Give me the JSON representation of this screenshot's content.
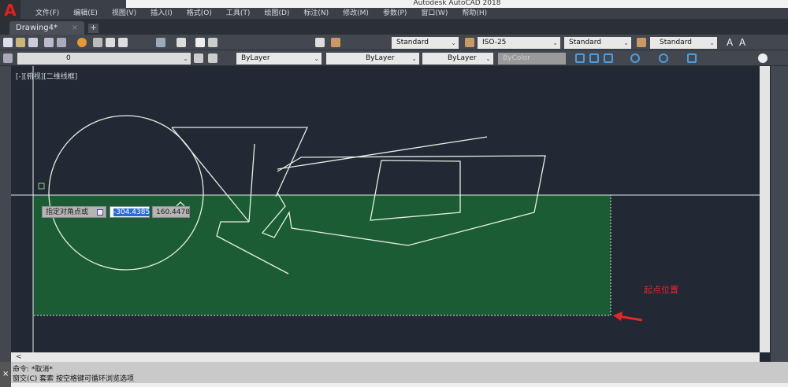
{
  "app": {
    "title": "Autodesk AutoCAD 2018"
  },
  "menu": [
    "文件(F)",
    "编辑(E)",
    "视图(V)",
    "插入(I)",
    "格式(O)",
    "工具(T)",
    "绘图(D)",
    "标注(N)",
    "修改(M)",
    "参数(P)",
    "窗口(W)",
    "帮助(H)"
  ],
  "tabs": {
    "active": "Drawing4*",
    "close": "×",
    "new": "+"
  },
  "toolbar": {
    "text_style": "Standard",
    "dim_style": "ISO-25",
    "table_style": "Standard",
    "mleader_style": "Standard",
    "layer": "0",
    "color": "ByLayer",
    "linetype": "ByLayer",
    "lineweight": "ByLayer",
    "plotstyle": "ByColor"
  },
  "viewport": {
    "label": "[-][俯视][二维线框]"
  },
  "dynamic_input": {
    "prompt": "指定对角点或",
    "x_value": "-304.4385",
    "y_value": "160.4478"
  },
  "annotation": {
    "text": "起点位置",
    "color": "#e02a2a"
  },
  "selection": {
    "fill": "#1b5c34"
  },
  "command": {
    "history1": "命令: *取消*",
    "history2": "窗交(C)  套索    按空格键可循环浏览选项",
    "close": "×"
  },
  "scroll": {
    "left_arrow": "<"
  }
}
